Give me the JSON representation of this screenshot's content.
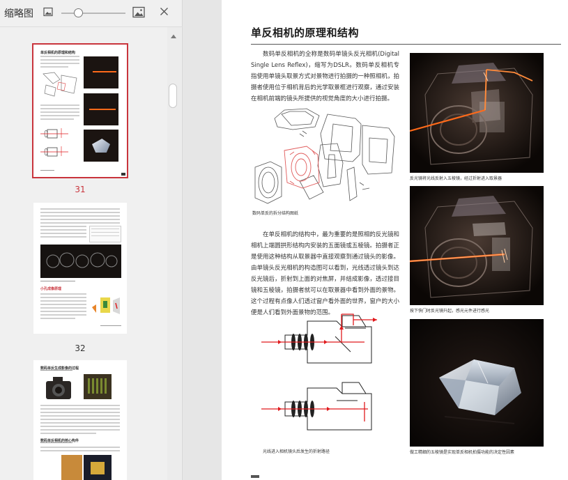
{
  "sidebar": {
    "title": "缩略图",
    "thumbnails": [
      {
        "page_number": "31",
        "selected": true
      },
      {
        "page_number": "32",
        "selected": false
      },
      {
        "page_number": "",
        "selected": false
      }
    ],
    "thumb_text": {
      "t31_heading": "单反相机的原理和结构",
      "t33_heading1": "数码单反生成影像的过程",
      "t33_heading2": "数码单反相机的核心构件",
      "t32_heading": "小孔成像原理"
    }
  },
  "document": {
    "section_title": "单反相机的原理和结构",
    "paragraph_1": "数码单反相机的全称是数码单镜头反光相机(Digital Single Lens Reflex)，缩写为DSLR。数码单反相机专指使用单镜头取景方式对景物进行拍摄的一种照相机，拍摄者使用位于相机背后的光学取景框进行观察，通过安装在相机前端的镜头所提供的视觉角度的大小进行拍摄。",
    "paragraph_2": "在单反相机的结构中，最为重要的是照相的反光镜和相机上端圆拱形结构内安装的五面镜或五棱镜。拍摄者正是使用这种结构从取景器中直接观察到通过镜头的影像。由单镜头反光相机的构造图可以看到，光线透过镜头到达反光镜后，折射到上面的对焦屏，并结成影像，透过接目镜和五棱镜，拍摄者就可以在取景器中看到外面的景物。这个过程有点像人们透过窗户看外面的世界，窗户的大小便是人们看到外面景物的范围。",
    "caption_diagram": "数码单反的拆分结构图纸",
    "caption_optical": "光线进入相机镜头后发生的折射路径",
    "caption_photo_1": "反光镜将光线反射入五棱镜，经过折射进入取景器",
    "caption_photo_2": "按下快门时反光镜升起，感光元件进行感光",
    "caption_photo_3": "做工精细的五棱镜是实现单反相机拍摄功能的决定性因素"
  },
  "colors": {
    "accent_red": "#c9343c",
    "light_beam": "#ff6a1a",
    "optical_red": "#e0191c"
  }
}
